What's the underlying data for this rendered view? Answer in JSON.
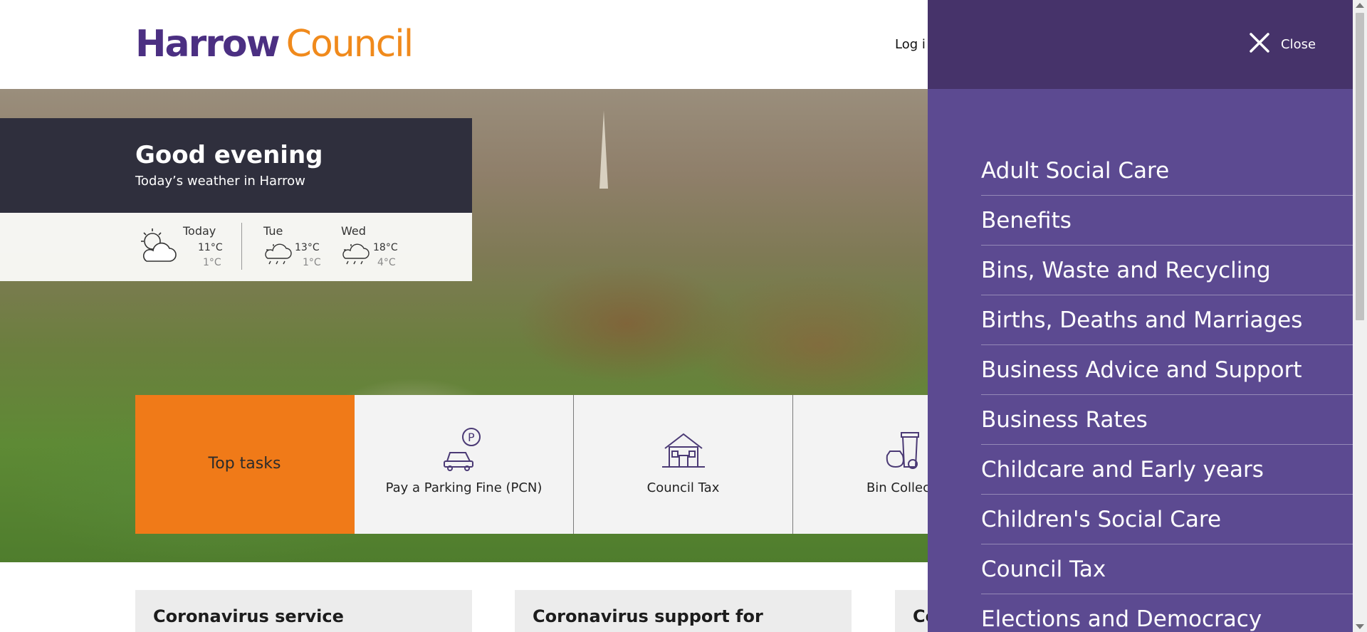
{
  "header": {
    "logo_harrow": "Harrow",
    "logo_council": "Council",
    "login_label": "Log i"
  },
  "greeting": {
    "title": "Good evening",
    "subtitle": "Today’s weather in Harrow"
  },
  "weather": [
    {
      "day": "Today",
      "high": "11°C",
      "low": "1°C",
      "icon": "sun-cloud-icon"
    },
    {
      "day": "Tue",
      "high": "13°C",
      "low": "1°C",
      "icon": "cloud-sun-icon"
    },
    {
      "day": "Wed",
      "high": "18°C",
      "low": "4°C",
      "icon": "cloud-sun-icon"
    }
  ],
  "tasks": {
    "heading": "Top tasks",
    "items": [
      {
        "label": "Pay a Parking Fine (PCN)",
        "icon": "car-parking-icon"
      },
      {
        "label": "Council Tax",
        "icon": "house-icon"
      },
      {
        "label": "Bin Collecti",
        "icon": "bin-icon"
      }
    ]
  },
  "cards": [
    {
      "title": "Coronavirus service"
    },
    {
      "title": "Coronavirus support for"
    },
    {
      "title": "Co"
    }
  ],
  "menu": {
    "close_label": "Close",
    "items": [
      "Adult Social Care",
      "Benefits",
      "Bins, Waste and Recycling",
      "Births, Deaths and Marriages",
      "Business Advice and Support",
      "Business Rates",
      "Childcare and Early years",
      "Children's Social Care",
      "Council Tax",
      "Elections and Democracy"
    ]
  },
  "colors": {
    "brand_purple": "#4b2f82",
    "brand_orange": "#f08a1c",
    "menu_bg": "#5c4a91",
    "menu_head_bg": "#46336a",
    "task_primary": "#f07a18"
  }
}
